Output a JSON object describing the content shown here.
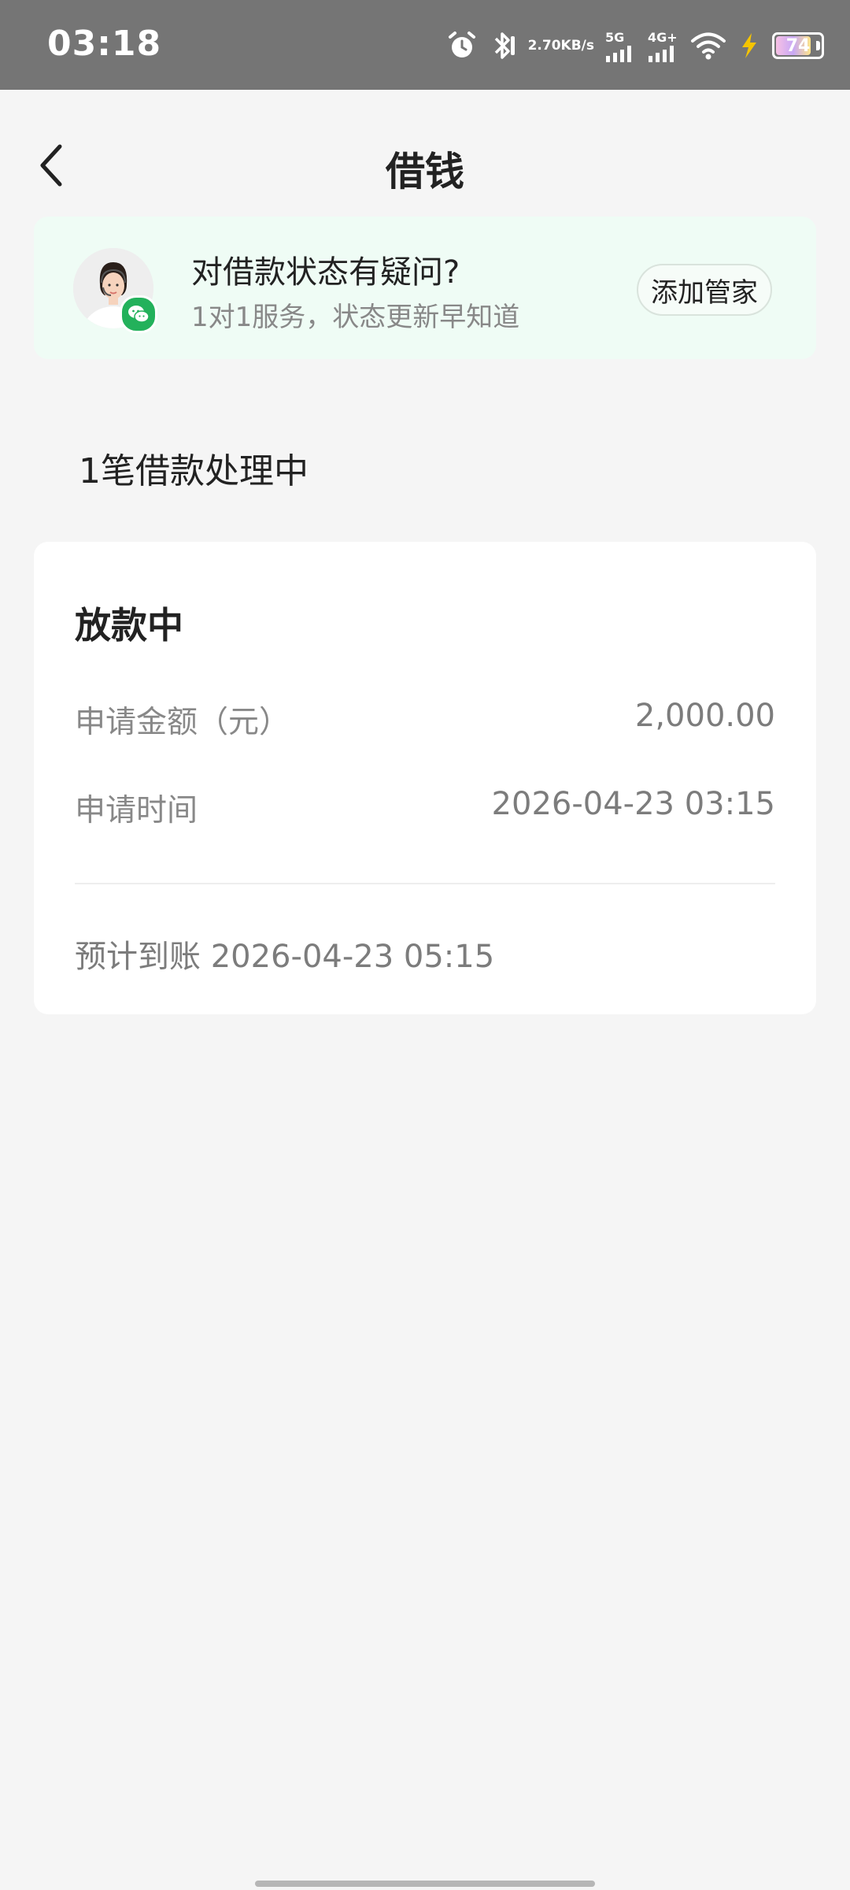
{
  "status_bar": {
    "time": "03:18",
    "net_speed_value": "2.70",
    "net_speed_unit": "KB/s",
    "net1": "5G",
    "net2": "4G+",
    "battery_level": 74,
    "battery_text": "74",
    "icons": [
      "alarm-icon",
      "bluetooth-icon",
      "signal-5g-icon",
      "signal-4g-icon",
      "wifi-icon",
      "charging-icon",
      "battery-icon"
    ]
  },
  "header": {
    "title": "借钱",
    "back_icon": "chevron-left-icon"
  },
  "service_banner": {
    "title": "对借款状态有疑问?",
    "subtitle": "1对1服务，状态更新早知道",
    "button_label": "添加管家",
    "avatar": "service-agent-avatar",
    "badge_icon": "wechat-icon",
    "background": "#effcf5",
    "badge_color": "#23b15b"
  },
  "loans": {
    "section_title": "1笔借款处理中",
    "items": [
      {
        "status": "放款中",
        "amount_label": "申请金额（元）",
        "amount_value": "2,000.00",
        "time_label": "申请时间",
        "time_value": "2026-04-23 03:15",
        "eta_text": "预计到账 2026-04-23 05:15"
      }
    ]
  }
}
